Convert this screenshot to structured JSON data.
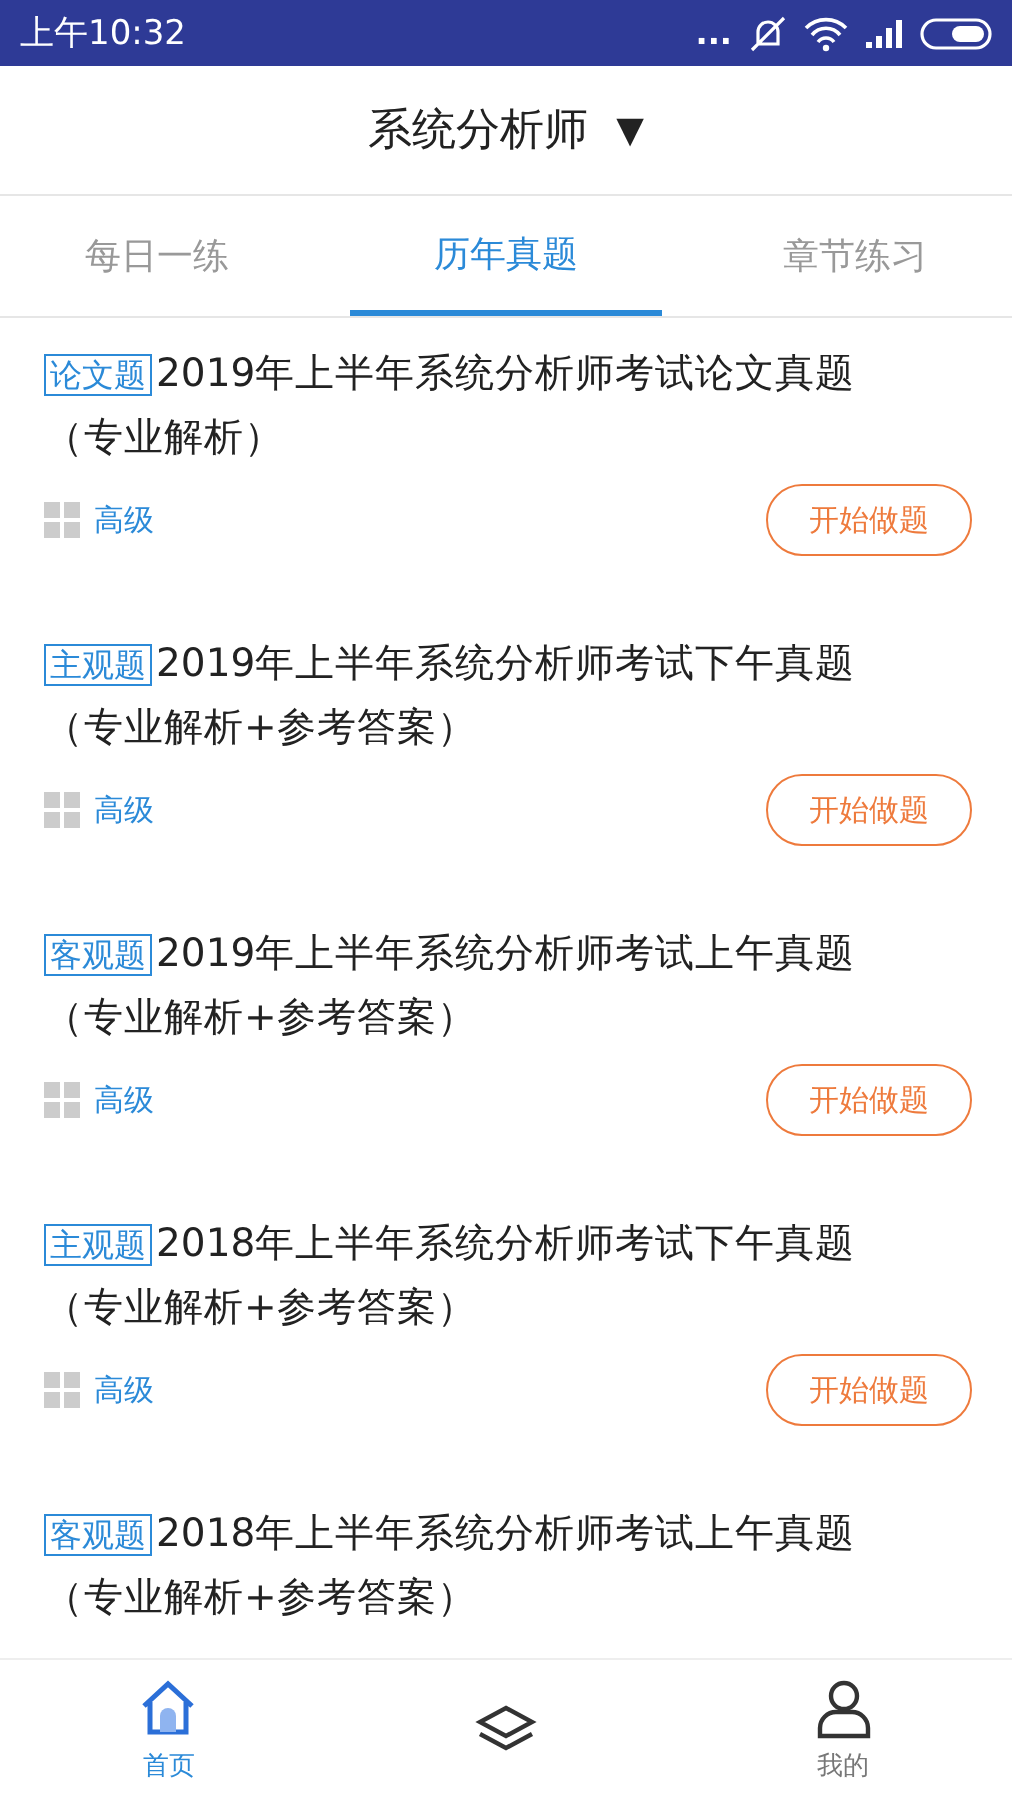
{
  "status_bar": {
    "time": "上午10:32",
    "dots": "..."
  },
  "header": {
    "title": "系统分析师",
    "caret": "▼"
  },
  "tabs": [
    {
      "label": "每日一练",
      "selected": false
    },
    {
      "label": "历年真题",
      "selected": true
    },
    {
      "label": "章节练习",
      "selected": false
    }
  ],
  "papers": [
    {
      "tag": "论文题",
      "title": "2019年上半年系统分析师考试论文真题",
      "subtitle": "（专业解析）",
      "level": "高级",
      "button": "开始做题"
    },
    {
      "tag": "主观题",
      "title": "2019年上半年系统分析师考试下午真题",
      "subtitle": "（专业解析+参考答案）",
      "level": "高级",
      "button": "开始做题"
    },
    {
      "tag": "客观题",
      "title": "2019年上半年系统分析师考试上午真题",
      "subtitle": "（专业解析+参考答案）",
      "level": "高级",
      "button": "开始做题"
    },
    {
      "tag": "主观题",
      "title": "2018年上半年系统分析师考试下午真题",
      "subtitle": "（专业解析+参考答案）",
      "level": "高级",
      "button": "开始做题"
    },
    {
      "tag": "客观题",
      "title": "2018年上半年系统分析师考试上午真题",
      "subtitle": "（专业解析+参考答案）"
    }
  ],
  "bottom_nav": [
    {
      "kind": "home",
      "label": "首页",
      "selected": true
    },
    {
      "kind": "courses",
      "selected": false
    },
    {
      "kind": "profile",
      "label": "我的",
      "selected": false
    }
  ]
}
